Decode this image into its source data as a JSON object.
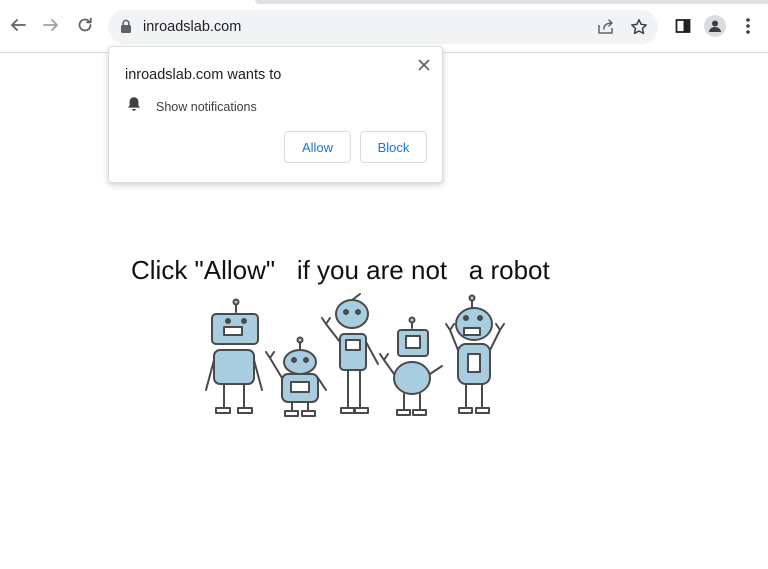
{
  "browser": {
    "url": "inroadslab.com",
    "icons": {
      "back": "arrow-left-icon",
      "forward": "arrow-right-icon",
      "reload": "reload-icon",
      "lock": "lock-icon",
      "share": "share-icon",
      "bookmark": "star-icon",
      "side_panel": "side-panel-icon",
      "profile": "profile-icon",
      "menu": "kebab-menu-icon"
    }
  },
  "popup": {
    "title": "inroadslab.com wants to",
    "permission_label": "Show notifications",
    "allow_label": "Allow",
    "block_label": "Block",
    "icons": {
      "close": "close-icon",
      "permission": "bell-icon"
    }
  },
  "page": {
    "headline": "Click \"Allow\"   if you are not   a robot",
    "image": "robots-illustration"
  },
  "colors": {
    "accent": "#1a73e8",
    "robot_fill": "#a9cde0",
    "robot_outline": "#4a4a4a"
  }
}
